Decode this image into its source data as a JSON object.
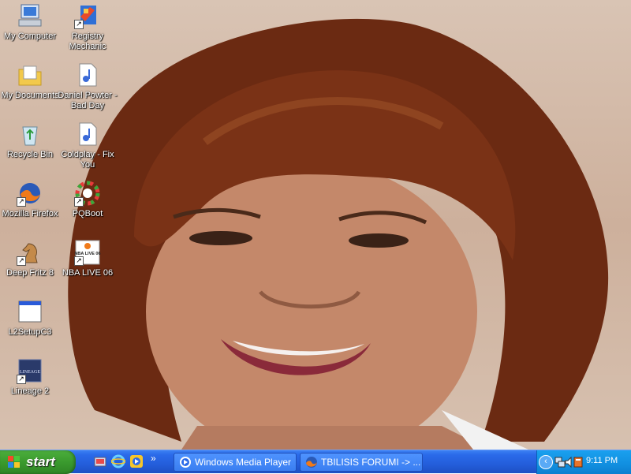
{
  "desktop": {
    "icons": [
      {
        "label": "My Computer",
        "icon": "computer-icon"
      },
      {
        "label": "Registry Mechanic",
        "icon": "registry-mechanic-icon"
      },
      {
        "label": "My Documents",
        "icon": "folder-documents-icon"
      },
      {
        "label": "Daniel Powter - Bad Day",
        "icon": "audio-file-icon"
      },
      {
        "label": "Recycle Bin",
        "icon": "recycle-bin-icon"
      },
      {
        "label": "Coldplay - Fix You",
        "icon": "audio-file-icon"
      },
      {
        "label": "Mozilla Firefox",
        "icon": "firefox-icon"
      },
      {
        "label": "PQBoot",
        "icon": "pqboot-icon"
      },
      {
        "label": "Deep Fritz 8",
        "icon": "chess-knight-icon"
      },
      {
        "label": "NBA LIVE 06",
        "icon": "nba-live-icon"
      },
      {
        "label": "L2SetupC3",
        "icon": "window-app-icon"
      },
      {
        "label": "Lineage 2",
        "icon": "lineage-icon"
      }
    ],
    "icon_image_text": {
      "nba": "NBA LIVE 06",
      "lineage": "LINEAGE"
    },
    "wallpaper": "portrait photo of a smiling woman"
  },
  "taskbar": {
    "start_label": "start",
    "quick_launch": [
      "media-icon",
      "internet-explorer-icon",
      "media-player-icon"
    ],
    "overflow": "»",
    "tasks": [
      {
        "label": "Windows Media Player",
        "icon": "media-player-icon"
      },
      {
        "label": "TBILISIS FORUMI -> ...",
        "icon": "firefox-icon"
      }
    ],
    "tray": {
      "icons": [
        "expand-tray-icon",
        "network-icon",
        "speaker-icon",
        "app-tray-icon"
      ],
      "clock": "9:11 PM"
    }
  },
  "colors": {
    "taskbar": "#245edb",
    "start": "#3a9a2e",
    "tray": "#118fe0"
  }
}
